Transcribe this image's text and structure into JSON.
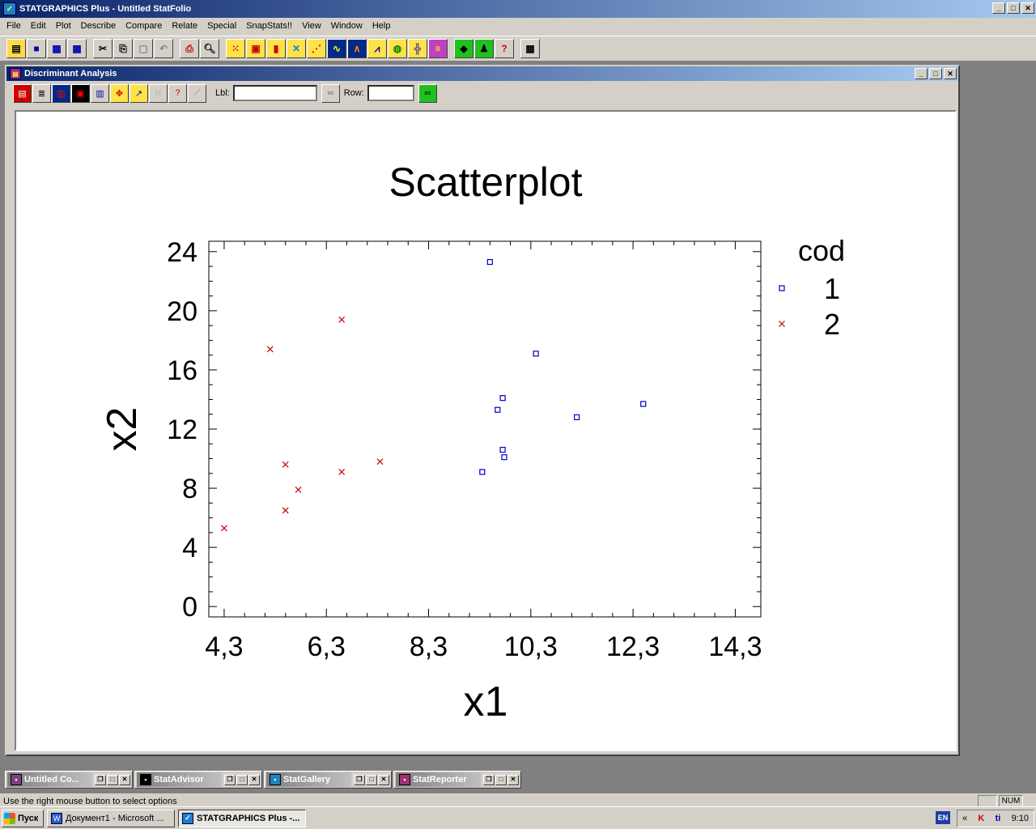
{
  "app": {
    "title": "STATGRAPHICS Plus - Untitled StatFolio"
  },
  "menu": [
    "File",
    "Edit",
    "Plot",
    "Describe",
    "Compare",
    "Relate",
    "Special",
    "SnapStats!!",
    "View",
    "Window",
    "Help"
  ],
  "child_window": {
    "title": "Discriminant Analysis",
    "lbl_label": "Lbl:",
    "lbl_value": "",
    "row_label": "Row:",
    "row_value": ""
  },
  "chart_data": {
    "type": "scatter",
    "title": "Scatterplot",
    "xlabel": "x1",
    "ylabel": "x2",
    "xlim": [
      4.0,
      14.8
    ],
    "ylim": [
      -0.7,
      24.7
    ],
    "x_ticks": [
      "4,3",
      "6,3",
      "8,3",
      "10,3",
      "12,3",
      "14,3"
    ],
    "x_tick_values": [
      4.3,
      6.3,
      8.3,
      10.3,
      12.3,
      14.3
    ],
    "y_ticks": [
      "0",
      "4",
      "8",
      "12",
      "16",
      "20",
      "24"
    ],
    "y_tick_values": [
      0,
      4,
      8,
      12,
      16,
      20,
      24
    ],
    "legend_title": "cod",
    "legend_position": "right",
    "series": [
      {
        "name": "1",
        "marker": "square",
        "color": "#0000c8",
        "points": [
          [
            9.5,
            23.3
          ],
          [
            10.4,
            17.1
          ],
          [
            9.75,
            14.1
          ],
          [
            9.65,
            13.3
          ],
          [
            11.2,
            12.8
          ],
          [
            12.5,
            13.7
          ],
          [
            9.75,
            10.6
          ],
          [
            9.78,
            10.1
          ],
          [
            9.35,
            9.1
          ]
        ]
      },
      {
        "name": "2",
        "marker": "x",
        "color": "#c80000",
        "points": [
          [
            6.6,
            19.4
          ],
          [
            5.2,
            17.4
          ],
          [
            5.5,
            9.6
          ],
          [
            5.75,
            7.9
          ],
          [
            5.5,
            6.5
          ],
          [
            6.6,
            9.1
          ],
          [
            7.35,
            9.8
          ],
          [
            4.3,
            5.3
          ]
        ]
      }
    ]
  },
  "minimized": [
    {
      "title": "Untitled Co..."
    },
    {
      "title": "StatAdvisor"
    },
    {
      "title": "StatGallery"
    },
    {
      "title": "StatReporter"
    }
  ],
  "status": {
    "text": "Use the right mouse button to select options",
    "num": "NUM"
  },
  "taskbar": {
    "start": "Пуск",
    "tasks": [
      "Документ1 - Microsoft ...",
      "STATGRAPHICS Plus -..."
    ],
    "lang": "EN",
    "clock": "9:10"
  },
  "colors": {
    "title_active": "#0a246a",
    "series1": "#0000c8",
    "series2": "#c80000"
  }
}
